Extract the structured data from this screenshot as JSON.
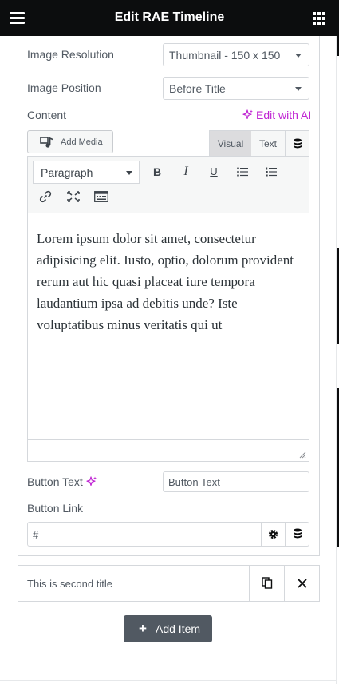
{
  "header": {
    "title": "Edit RAE Timeline",
    "menu_icon": "hamburger-icon",
    "widgets_icon": "grid-icon",
    "background": "#0c0d0e"
  },
  "fields": {
    "image_resolution": {
      "label": "Image Resolution",
      "value": "Thumbnail - 150 x 150"
    },
    "image_position": {
      "label": "Image Position",
      "value": "Before Title"
    },
    "content": {
      "label": "Content",
      "ai_link": "Edit with AI",
      "add_media": "Add Media",
      "tabs": [
        "Visual",
        "Text"
      ],
      "active_tab": "Visual",
      "format": "Paragraph",
      "text": "Lorem ipsum dolor sit amet, consectetur adipisicing elit. Iusto, optio, dolorum provident rerum aut hic quasi placeat iure tempora laudantium ipsa ad debitis unde? Iste voluptatibus minus veritatis qui ut"
    },
    "button_text": {
      "label": "Button Text",
      "placeholder": "Button Text"
    },
    "button_link": {
      "label": "Button Link",
      "value": "#"
    }
  },
  "repeater": {
    "second_item_title": "This is second title",
    "add_item_label": "Add Item"
  },
  "colors": {
    "ai_accent": "#c026d3",
    "button_bg": "#515962",
    "border": "#d5d8dc"
  }
}
